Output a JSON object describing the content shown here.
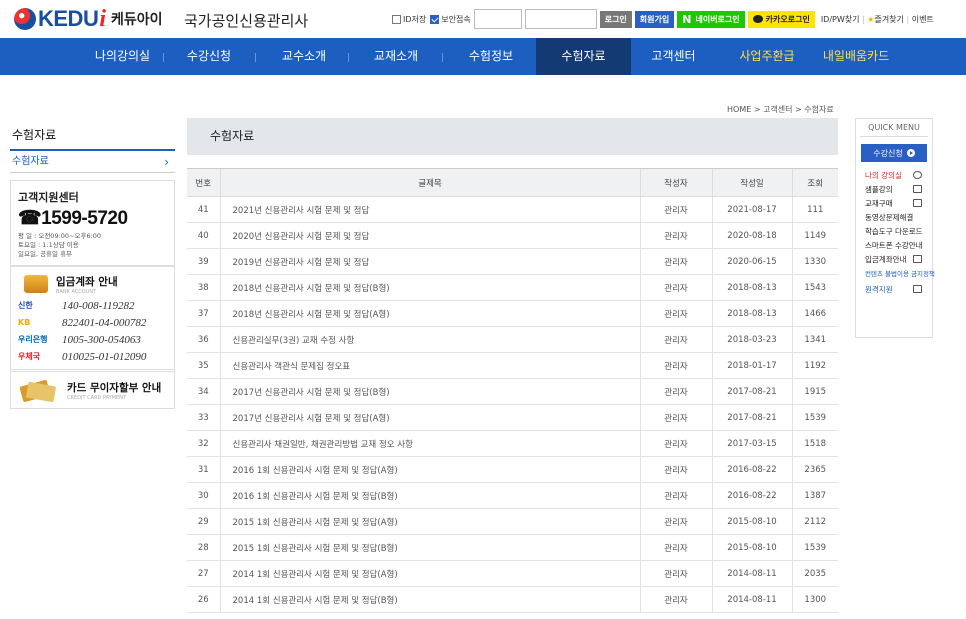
{
  "header": {
    "logo_text": "KEDU",
    "logo_i": "i",
    "logo_korean": "케듀아이",
    "site_title": "국가공인신용관리사",
    "id_save": "ID저장",
    "secure_login": "보안접속",
    "login": "로그인",
    "join": "회원가입",
    "naver_n": "N",
    "naver_login": "네이버로그인",
    "kakao_login": "카카오로그인",
    "find_idpw": "ID/PW찾기",
    "favorites": "즐겨찾기",
    "event": "이벤트"
  },
  "gnb": {
    "items": [
      "나의강의실",
      "수강신청",
      "교수소개",
      "교재소개",
      "수험정보",
      "수험자료",
      "고객센터",
      "사업주환급",
      "내일배움카드"
    ],
    "active_index": 5
  },
  "breadcrumb": "HOME > 고객센터 > 수험자료",
  "sidebar": {
    "title": "수험자료",
    "items": [
      {
        "label": "수험자료",
        "arrow": "›"
      }
    ]
  },
  "support": {
    "title": "고객지원센터",
    "phone": "☎1599-5720",
    "hours_weekday": "평  일 : 오전09:00~오후6:00",
    "hours_sat": "토요일 : 1:1상담 이용",
    "hours_holiday": "일요일, 공휴일 휴무"
  },
  "bank": {
    "title": "입금계좌 안내",
    "subtitle": "BANK ACCOUNT",
    "accounts": [
      {
        "bank": "신한",
        "number": "140-008-119282",
        "color": "#1a4fa0"
      },
      {
        "bank": "KB",
        "number": "822401-04-000782",
        "color": "#f2a900"
      },
      {
        "bank": "우리은행",
        "number": "1005-300-054063",
        "color": "#0067ac"
      },
      {
        "bank": "우체국",
        "number": "010025-01-012090",
        "color": "#e3242b"
      }
    ]
  },
  "card": {
    "title": "카드 무이자할부 안내",
    "subtitle": "CREDIT CARD PAYMENT"
  },
  "content": {
    "title": "수험자료",
    "columns": [
      "번호",
      "글제목",
      "작성자",
      "작성일",
      "조회"
    ],
    "rows": [
      {
        "no": "41",
        "title": "2021년 신용관리사 시험 문제 및 정답",
        "author": "관리자",
        "date": "2021-08-17",
        "views": "111"
      },
      {
        "no": "40",
        "title": "2020년 신용관리사 시험 문제 및 정답",
        "author": "관리자",
        "date": "2020-08-18",
        "views": "1149"
      },
      {
        "no": "39",
        "title": "2019년 신용관리사 시험 문제 및 정답",
        "author": "관리자",
        "date": "2020-06-15",
        "views": "1330"
      },
      {
        "no": "38",
        "title": "2018년 신용관리사 시험 문제 및 정답(B형)",
        "author": "관리자",
        "date": "2018-08-13",
        "views": "1543"
      },
      {
        "no": "37",
        "title": "2018년 신용관리사 시험 문제 및 정답(A형)",
        "author": "관리자",
        "date": "2018-08-13",
        "views": "1466"
      },
      {
        "no": "36",
        "title": "신용관리실무(3권) 교재 수정 사항",
        "author": "관리자",
        "date": "2018-03-23",
        "views": "1341"
      },
      {
        "no": "35",
        "title": "신용관리사 객관식 문제집 정오표",
        "author": "관리자",
        "date": "2018-01-17",
        "views": "1192"
      },
      {
        "no": "34",
        "title": "2017년 신용관리사 시험 문제 및 정답(B형)",
        "author": "관리자",
        "date": "2017-08-21",
        "views": "1915"
      },
      {
        "no": "33",
        "title": "2017년 신용관리사 시험 문제 및 정답(A형)",
        "author": "관리자",
        "date": "2017-08-21",
        "views": "1539"
      },
      {
        "no": "32",
        "title": "신용관리사 채권일반, 채권관리방법 교재 정오 사항",
        "author": "관리자",
        "date": "2017-03-15",
        "views": "1518"
      },
      {
        "no": "31",
        "title": "2016 1회 신용관리사 시험 문제 및 정답(A형)",
        "author": "관리자",
        "date": "2016-08-22",
        "views": "2365"
      },
      {
        "no": "30",
        "title": "2016 1회 신용관리사 시험 문제 및 정답(B형)",
        "author": "관리자",
        "date": "2016-08-22",
        "views": "1387"
      },
      {
        "no": "29",
        "title": "2015 1회 신용관리사 시험 문제 및 정답(A형)",
        "author": "관리자",
        "date": "2015-08-10",
        "views": "2112"
      },
      {
        "no": "28",
        "title": "2015 1회 신용관리사 시험 문제 및 정답(B형)",
        "author": "관리자",
        "date": "2015-08-10",
        "views": "1539"
      },
      {
        "no": "27",
        "title": "2014 1회 신용관리사 시험 문제 및 정답(A형)",
        "author": "관리자",
        "date": "2014-08-11",
        "views": "2035"
      },
      {
        "no": "26",
        "title": "2014 1회 신용관리사 시험 문제 및 정답(B형)",
        "author": "관리자",
        "date": "2014-08-11",
        "views": "1300"
      }
    ]
  },
  "quick_menu": {
    "title": "QUICK MENU",
    "button": "수강신청",
    "items": [
      {
        "label": "나의 강의실",
        "style": "red",
        "icon": "user-icon"
      },
      {
        "label": "샘플강의",
        "style": "",
        "icon": "play-icon"
      },
      {
        "label": "교재구매",
        "style": "",
        "icon": "book-icon"
      },
      {
        "label": "동영상문제해결",
        "style": "",
        "icon": ""
      },
      {
        "label": "학습도구 다운로드",
        "style": "",
        "icon": ""
      },
      {
        "label": "스마트폰 수강안내",
        "style": "",
        "icon": ""
      },
      {
        "label": "입금계좌안내",
        "style": "",
        "icon": "card-icon"
      },
      {
        "label": "컨텐츠 불법이용 금지정책",
        "style": "small",
        "icon": ""
      },
      {
        "label": "원격지원",
        "style": "blue",
        "icon": "monitor-icon"
      }
    ]
  }
}
